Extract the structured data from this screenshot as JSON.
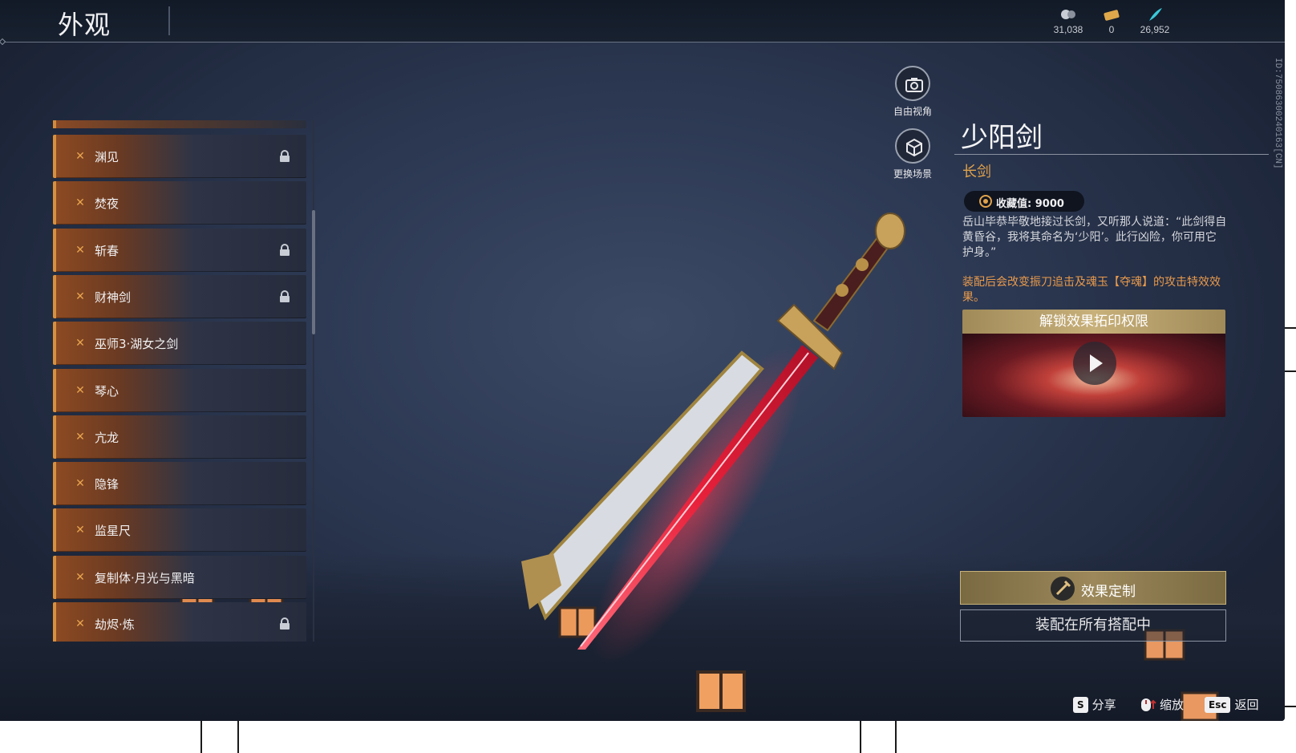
{
  "header": {
    "title": "外观"
  },
  "currencies": [
    {
      "icon": "spirit-orb-icon",
      "value": "31,038"
    },
    {
      "icon": "gold-ticket-icon",
      "value": "0"
    },
    {
      "icon": "jade-feather-icon",
      "value": "26,952"
    }
  ],
  "list": {
    "items": [
      {
        "label": "渊见",
        "locked": true
      },
      {
        "label": "焚夜",
        "locked": false
      },
      {
        "label": "斩春",
        "locked": true
      },
      {
        "label": "财神剑",
        "locked": true
      },
      {
        "label": "巫师3·湖女之剑",
        "locked": false
      },
      {
        "label": "琴心",
        "locked": false
      },
      {
        "label": "亢龙",
        "locked": false
      },
      {
        "label": "隐锋",
        "locked": false
      },
      {
        "label": "监星尺",
        "locked": false
      },
      {
        "label": "复制体·月光与黑暗",
        "locked": false
      },
      {
        "label": "劫烬·炼",
        "locked": true
      }
    ]
  },
  "view_controls": {
    "free_view": "自由视角",
    "change_scene": "更换场景"
  },
  "detail": {
    "name": "少阳剑",
    "type": "长剑",
    "collect_label": "收藏值: 9000",
    "description": "岳山毕恭毕敬地接过长剑，又听那人说道：“此剑得自黄昏谷，我将其命名为‘少阳’。此行凶险，你可用它护身。”",
    "effect": "装配后会改变振刀追击及魂玉【夺魂】的攻击特效效果。",
    "unlock_title": "解锁效果拓印权限",
    "custom_label": "效果定制",
    "equip_label": "装配在所有搭配中"
  },
  "id_text": "ID:7508630024016​3[CN]",
  "hints": [
    {
      "key": "S",
      "label": "分享"
    },
    {
      "key": "",
      "label": "缩放"
    },
    {
      "key": "Esc",
      "label": "返回"
    }
  ],
  "colors": {
    "accent": "#d8903e",
    "gold": "#e0a24a",
    "bg": "#2c3852"
  }
}
